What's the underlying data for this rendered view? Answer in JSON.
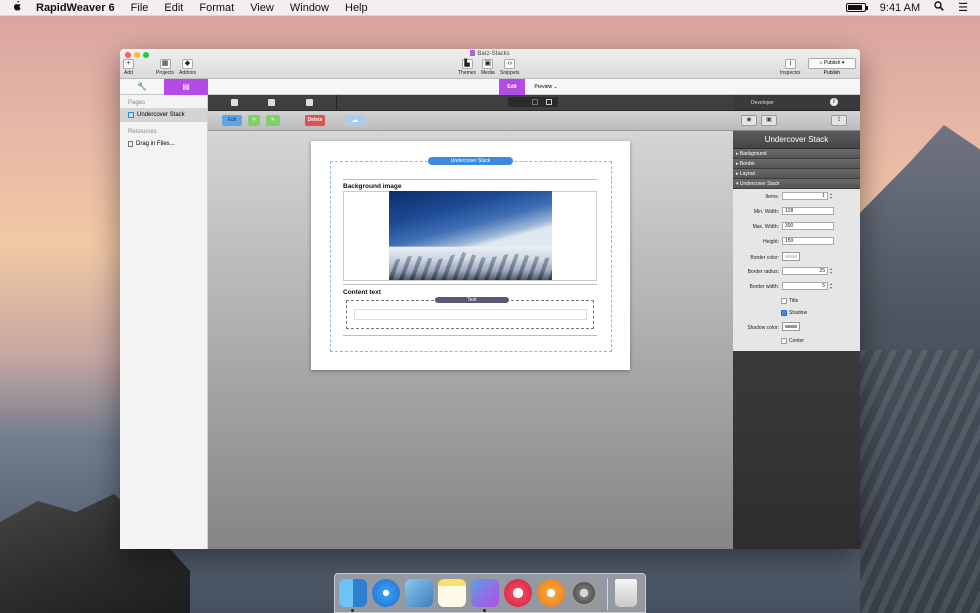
{
  "menubar": {
    "apple": "",
    "app_name": "RapidWeaver 6",
    "menus": [
      "File",
      "Edit",
      "Format",
      "View",
      "Window",
      "Help"
    ],
    "time": "9:41 AM",
    "search_icon": "magnifier",
    "list_icon": "☰"
  },
  "window": {
    "doc_title": "Barz-Stacks",
    "toolbar": {
      "add": "Add",
      "projects": "Projects",
      "addons": "Addons",
      "themes": "Themes",
      "media": "Media",
      "snippets": "Snippets",
      "inspector": "Inspector",
      "publish_btn": "Publish",
      "publish_label": "Publish"
    },
    "tabs": {
      "tools_icon": "🔧",
      "pages_icon": "▤",
      "edit": "Edit",
      "preview": "Preview ⌄"
    }
  },
  "sidebar": {
    "pages_heading": "Pages",
    "page_item": "Undercover Stack",
    "resources_heading": "Resources",
    "resource_item": "Drag in Files..."
  },
  "editor": {
    "buttons": {
      "edit": "Edit",
      "g1": "",
      "g2": "",
      "delete": "Delete",
      "cloud": "☁"
    },
    "stack_label": "Undercover Stack",
    "bg_title": "Background image",
    "content_title": "Content text",
    "text_label": "Text"
  },
  "inspector": {
    "developer": "Developer",
    "info": "i",
    "title": "Undercover Stack",
    "sections": [
      "Background",
      "Border",
      "Layout",
      "Undercover Stack"
    ],
    "props": {
      "items_label": "Items:",
      "items_value": "1",
      "min_width_label": "Min. Width:",
      "min_width_value": "128",
      "max_width_label": "Max. Width:",
      "max_width_value": "300",
      "height_label": "Height:",
      "height_value": "150",
      "border_color_label": "Border color:",
      "border_radius_label": "Border radius:",
      "border_radius_value": "25",
      "border_width_label": "Border width:",
      "border_width_value": "5",
      "title_label": "Title",
      "shadow_label": "Shadow",
      "shadow_color_label": "Shadow color:",
      "center_label": "Center"
    },
    "colors": {
      "border_color": "#d8d8d8",
      "shadow_color": "#8a96ac"
    }
  },
  "colors": {
    "accent": "#b44be7",
    "edit_blue": "#5fa4e6",
    "delete_red": "#e24f4f"
  },
  "dock": {
    "apps": [
      "finder-icon",
      "safari-icon",
      "preview-icon",
      "notes-icon",
      "rapidweaver-icon",
      "itunes-icon",
      "ibooks-icon",
      "system-preferences-icon",
      "trash-icon"
    ]
  }
}
